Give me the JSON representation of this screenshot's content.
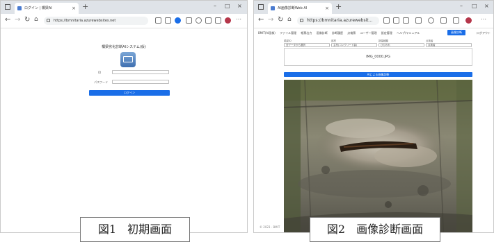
{
  "screen1": {
    "tab_title": "ログイン | 橋梁AI",
    "url": "https://bmnitaria.azurewebsites.net",
    "page_title": "橋梁劣化診断AIシステム(仮)",
    "id_label": "ID",
    "password_label": "パスワード",
    "login_button": "ログイン",
    "caption": "図1　初期画面"
  },
  "screen2": {
    "tab_title": "AI画像診断Web AI",
    "url": "https://bmnitaria.azurewebsit...",
    "menu": [
      "BMIT(AI画像)",
      "ファイル管理",
      "帳票出力",
      "画像診断",
      "診断履歴",
      "点検票",
      "ユーザー管理",
      "設定管理",
      "ヘルプ/マニュアル"
    ],
    "diagnose_button": "画像診断",
    "menu_right": "ログアウト",
    "selects": [
      {
        "label": "橋梁ID",
        "value": "全データから選択"
      },
      {
        "label": "部材",
        "value": "主桁(コンクリート製)"
      },
      {
        "label": "損傷種類",
        "value": "ひびわれ"
      },
      {
        "label": "点検者",
        "value": "点検者"
      }
    ],
    "filename": "IMG_0000.JPG",
    "run_button": "AIによる画像診断",
    "footer": "© 2023 - BMIT",
    "caption": "図2　画像診断画面"
  }
}
